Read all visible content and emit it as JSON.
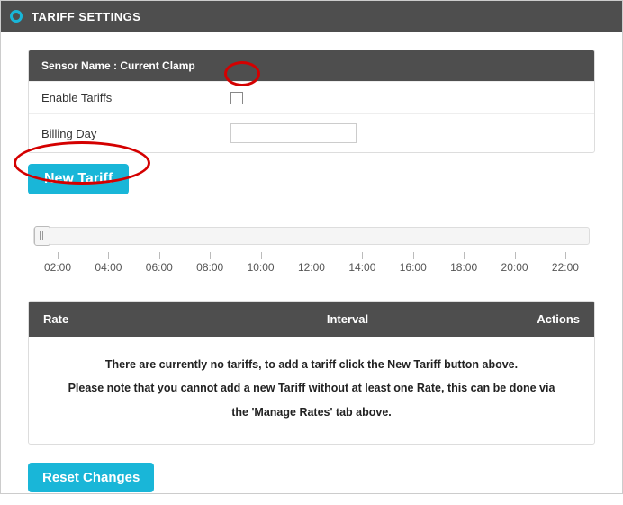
{
  "title": "TARIFF SETTINGS",
  "sensor_label": "Sensor Name : Current Clamp",
  "rows": {
    "enable_tariffs_label": "Enable Tariffs",
    "billing_day_label": "Billing Day",
    "billing_day_value": ""
  },
  "buttons": {
    "new_tariff": "New Tariff",
    "reset_changes": "Reset Changes"
  },
  "ticks": [
    "02:00",
    "04:00",
    "06:00",
    "08:00",
    "10:00",
    "12:00",
    "14:00",
    "16:00",
    "18:00",
    "20:00",
    "22:00"
  ],
  "table": {
    "col_rate": "Rate",
    "col_interval": "Interval",
    "col_actions": "Actions",
    "empty_line1": "There are currently no tariffs, to add a tariff click the New Tariff button above.",
    "empty_line2": "Please note that you cannot add a new Tariff without at least one Rate, this can be done via",
    "empty_line3": "the 'Manage Rates' tab above."
  }
}
